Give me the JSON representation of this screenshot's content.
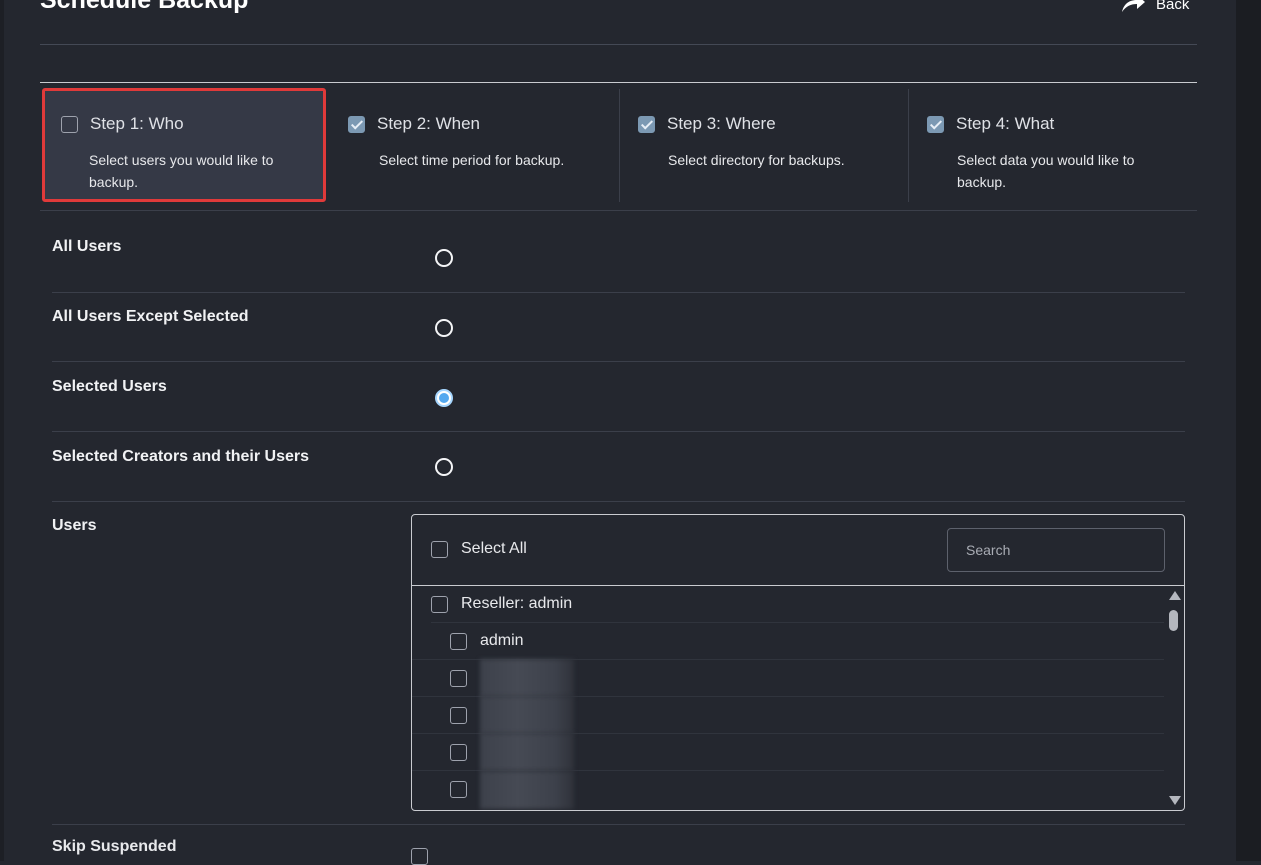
{
  "page": {
    "title": "Schedule Backup",
    "back_label": "Back"
  },
  "steps": [
    {
      "label": "Step 1: Who",
      "desc": "Select users you would like to backup.",
      "checked": false,
      "active": true
    },
    {
      "label": "Step 2: When",
      "desc": "Select time period for backup.",
      "checked": true,
      "active": false
    },
    {
      "label": "Step 3: Where",
      "desc": "Select directory for backups.",
      "checked": true,
      "active": false
    },
    {
      "label": "Step 4: What",
      "desc": "Select data you would like to backup.",
      "checked": true,
      "active": false
    }
  ],
  "options": [
    {
      "label": "All Users",
      "selected": false
    },
    {
      "label": "All Users Except Selected",
      "selected": false
    },
    {
      "label": "Selected Users",
      "selected": true
    },
    {
      "label": "Selected Creators and their Users",
      "selected": false
    }
  ],
  "users": {
    "label": "Users",
    "select_all": "Select All",
    "search_placeholder": "Search",
    "list": [
      {
        "text": "Reseller: admin",
        "level": 0,
        "checked": false
      },
      {
        "text": "admin",
        "level": 1,
        "checked": false
      },
      {
        "text": "",
        "level": 1,
        "checked": false,
        "redacted": true
      },
      {
        "text": "",
        "level": 1,
        "checked": false,
        "redacted": true
      },
      {
        "text": "",
        "level": 1,
        "checked": false,
        "redacted": true
      },
      {
        "text": "",
        "level": 1,
        "checked": false,
        "redacted": true
      }
    ]
  },
  "skip_suspended": {
    "label": "Skip Suspended",
    "checked": false
  },
  "colors": {
    "accent_active_border": "#e03a3a",
    "checkbox_checked": "#7c99b3",
    "radio_selected": "#53a8ef"
  }
}
